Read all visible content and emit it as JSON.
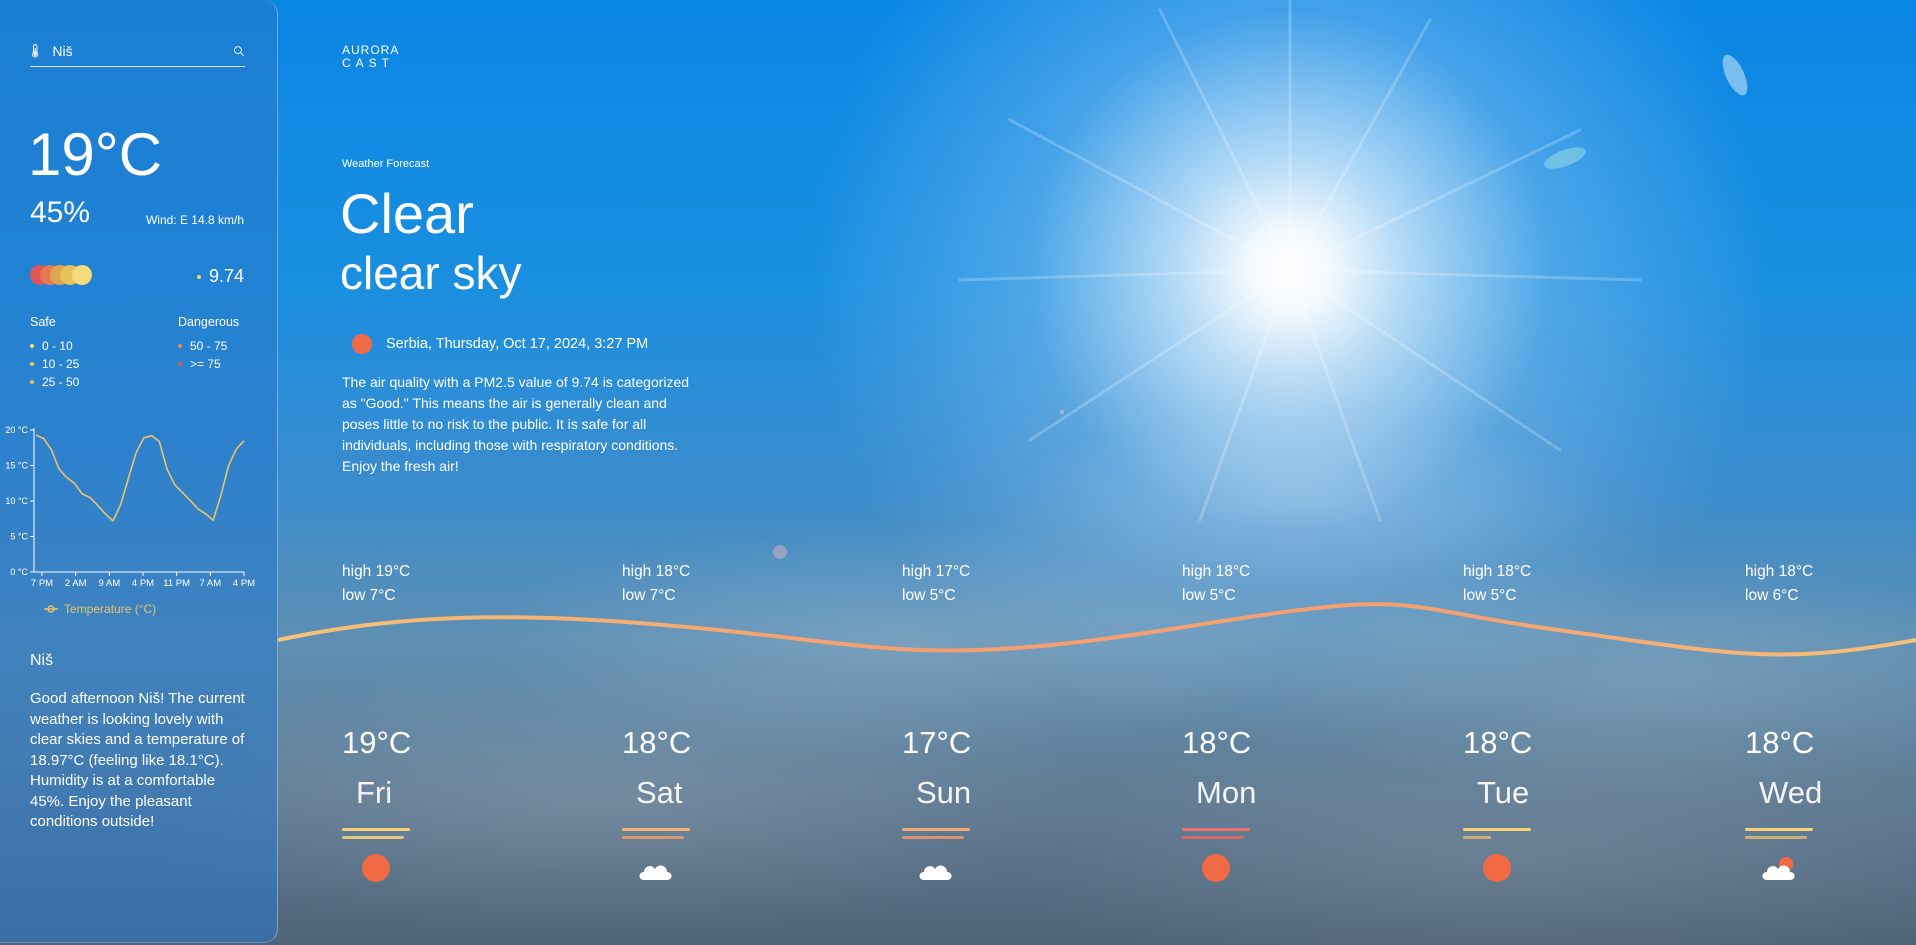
{
  "search": {
    "value": "Niš",
    "placeholder": ""
  },
  "current": {
    "temperature": "19°C",
    "humidity": "45%",
    "wind": "Wind: E 14.8 km/h",
    "aqi_value": "9.74"
  },
  "aqi_legend": {
    "safe_heading": "Safe",
    "danger_heading": "Dangerous",
    "safe_items": [
      {
        "label": "0 - 10",
        "color": "#f5e27a"
      },
      {
        "label": "10 - 25",
        "color": "#f0c94a"
      },
      {
        "label": "25 - 50",
        "color": "#e9b84a"
      }
    ],
    "danger_items": [
      {
        "label": "50 - 75",
        "color": "#e98a4a"
      },
      {
        "label": ">= 75",
        "color": "#e35454"
      }
    ],
    "dot_colors": [
      "#e05555",
      "#e57a52",
      "#dca54e",
      "#e8c25c",
      "#f3db7a"
    ]
  },
  "chart_data": {
    "type": "line",
    "x": [
      "7 PM",
      "2 AM",
      "9 AM",
      "4 PM",
      "11 PM",
      "7 AM",
      "4 PM"
    ],
    "y_ticks": [
      "0 °C",
      "5 °C",
      "10 °C",
      "15 °C",
      "20 °C"
    ],
    "ylim": [
      0,
      20
    ],
    "series": [
      {
        "name": "Temperature (°C)",
        "color": "#e9c46a",
        "values": [
          19.3,
          18.8,
          17.2,
          14.5,
          13.3,
          12.5,
          11.0,
          10.5,
          9.4,
          8.2,
          7.2,
          9.5,
          13.2,
          16.8,
          18.9,
          19.2,
          18.4,
          14.5,
          12.3,
          11.2,
          10.1,
          8.9,
          8.2,
          7.3,
          10.8,
          15.0,
          17.3,
          18.5
        ]
      }
    ]
  },
  "sidebar_city": "Niš",
  "sidebar_blurb": "Good afternoon Niš! The current weather is looking lovely with clear skies and a temperature of 18.97°C (feeling like 18.1°C). Humidity is at a comfortable 45%. Enjoy the pleasant conditions outside!",
  "logo": {
    "line1": "AURORA",
    "line2": "CAST"
  },
  "main": {
    "section_label": "Weather Forecast",
    "condition": "Clear",
    "condition_detail": "clear sky",
    "location_time": "Serbia, Thursday, Oct 17, 2024, 3:27 PM",
    "description": "The air quality with a PM2.5 value of 9.74 is categorized as \"Good.\" This means the air is generally clean and poses little to no risk to the public. It is safe for all individuals, including those with respiratory conditions. Enjoy the fresh air!"
  },
  "forecast": [
    {
      "high": "high 19°C",
      "low": "low 7°C",
      "temp": "19°C",
      "day": "Fri",
      "icon": "sun-icon",
      "bar_top": "#f5cf7a",
      "bar_bottom": "#e3c68a"
    },
    {
      "high": "high 18°C",
      "low": "low 7°C",
      "temp": "18°C",
      "day": "Sat",
      "icon": "cloud-icon",
      "bar_top": "#f4b07a",
      "bar_bottom": "#d99a75"
    },
    {
      "high": "high 17°C",
      "low": "low 5°C",
      "temp": "17°C",
      "day": "Sun",
      "icon": "cloud-icon",
      "bar_top": "#f4a77a",
      "bar_bottom": "#d99274"
    },
    {
      "high": "high 18°C",
      "low": "low 5°C",
      "temp": "18°C",
      "day": "Mon",
      "icon": "sun-icon",
      "bar_top": "#ec7070",
      "bar_bottom": "#d46a6a"
    },
    {
      "high": "high 18°C",
      "low": "low 5°C",
      "temp": "18°C",
      "day": "Tue",
      "icon": "sun-icon",
      "bar_top": "#f5d17a",
      "bar_bottom": "#c8b07a"
    },
    {
      "high": "high 18°C",
      "low": "low 6°C",
      "temp": "18°C",
      "day": "Wed",
      "icon": "cloud-sun-icon",
      "bar_top": "#f5d17a",
      "bar_bottom": "#c8b07a"
    }
  ],
  "wave_colors": {
    "left": "#f6c27a",
    "mid": "#f4a070",
    "right": "#f5c07a"
  }
}
